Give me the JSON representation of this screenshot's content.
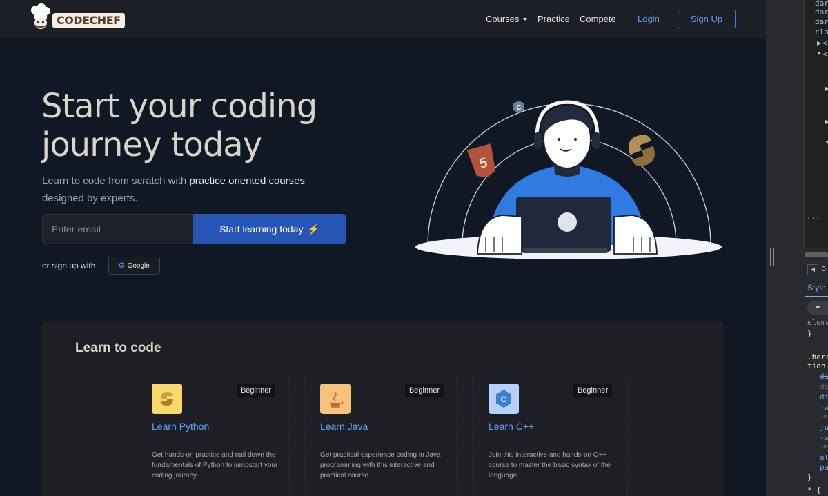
{
  "navbar": {
    "logo_text": "CODECHEF",
    "courses": "Courses",
    "practice": "Practice",
    "compete": "Compete",
    "login": "Login",
    "signup": "Sign Up"
  },
  "hero": {
    "title": "Start your coding journey today",
    "subtitle_start": "Learn to code from scratch with ",
    "subtitle_highlight": "practice oriented courses",
    "subtitle_end": " designed by experts.",
    "email_placeholder": "Enter email",
    "start_button": "Start learning today",
    "or_signup": "or sign up with",
    "google": "Google"
  },
  "learn": {
    "title": "Learn to code",
    "courses": [
      {
        "title": "Learn Python",
        "level": "Beginner",
        "description": "Get hands-on practice and nail down the fundamentals of Python to jumpstart your coding journey",
        "icon": "python-icon",
        "icon_bg": "#f9d96b"
      },
      {
        "title": "Learn Java",
        "level": "Beginner",
        "description": "Get practical experience coding in Java programming with this interactive and practical course",
        "icon": "java-icon",
        "icon_bg": "#f6c27c"
      },
      {
        "title": "Learn C++",
        "level": "Beginner",
        "description": "Join this interactive and hands-on C++ course to master the basic syntax of the language.",
        "icon": "cpp-icon",
        "icon_bg": "#b2d3f7"
      }
    ]
  },
  "devtools": {
    "dom_lines": [
      "dar",
      "dar",
      "dar",
      "cla",
      "<",
      "<"
    ],
    "dots": "···",
    "tab_letter": "o",
    "styles_tab": "Style",
    "elements_text": "eleme",
    "close_brace": "}",
    "selector_line1": ".herc",
    "selector_line2": "tion",
    "props": [
      "di",
      "di",
      "di",
      "-w",
      "-m",
      "ju",
      "-w",
      "-m",
      "al",
      "pa"
    ],
    "end_brace": "}",
    "universal": "* {"
  },
  "colors": {
    "accent_blue": "#61a4ff",
    "button_blue": "#2755b3",
    "hero_bg": "#101825",
    "navbar_bg": "#1c1f26",
    "card_bg": "#1d1f24"
  }
}
